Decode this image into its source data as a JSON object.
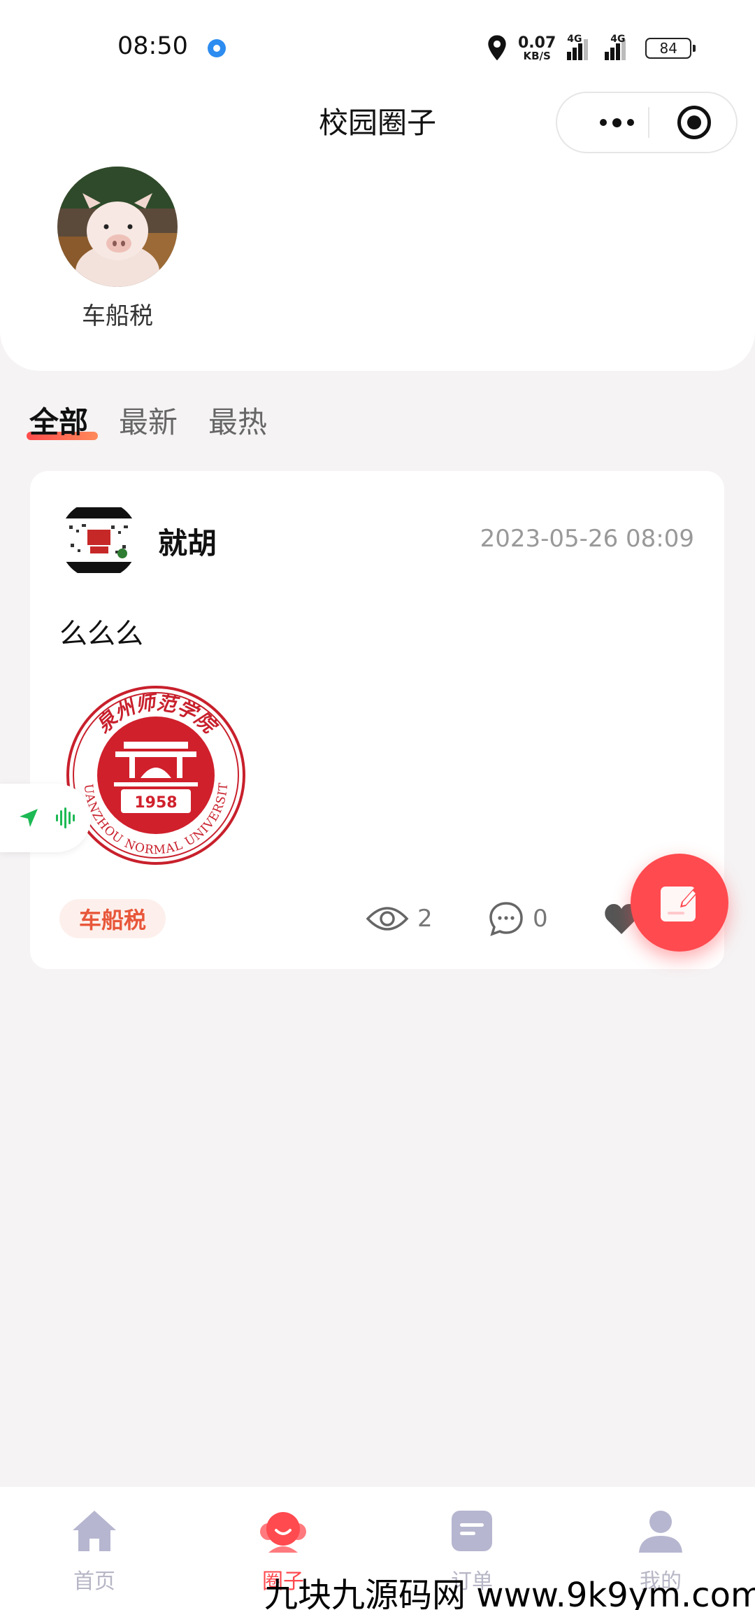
{
  "status_bar": {
    "time": "08:50",
    "net_speed_value": "0.07",
    "net_speed_unit": "KB/S",
    "sig1_label": "4G",
    "sig2_label": "4G",
    "battery": "84"
  },
  "header": {
    "title": "校园圈子"
  },
  "circles": [
    {
      "name": "车船税"
    }
  ],
  "tabs": [
    {
      "label": "全部",
      "active": true
    },
    {
      "label": "最新",
      "active": false
    },
    {
      "label": "最热",
      "active": false
    }
  ],
  "post": {
    "username": "就胡",
    "time": "2023-05-26 08:09",
    "text": "么么么",
    "image": {
      "top_text": "泉州师范学院",
      "year": "1958",
      "bottom_text": "QUANZHOU NORMAL UNIVERSITY"
    },
    "tag": "车船税",
    "views": "2",
    "comments": "0"
  },
  "tabbar": [
    {
      "label": "首页",
      "active": false
    },
    {
      "label": "圈子",
      "active": true
    },
    {
      "label": "订单",
      "active": false
    },
    {
      "label": "我的",
      "active": false
    }
  ],
  "watermark": "九块九源码网 www.9k9ym.com",
  "colors": {
    "accent": "#ff4a4f",
    "tag_bg": "#fdf0ec",
    "tag_text": "#e8573a",
    "page_bg": "#f5f3f4",
    "tabbar_inactive": "#b6b6c6"
  }
}
